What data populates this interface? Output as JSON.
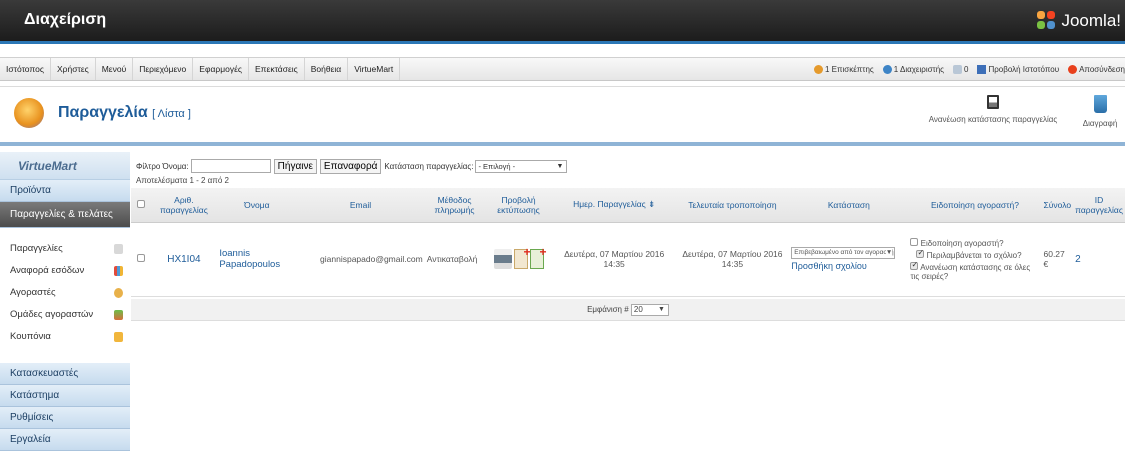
{
  "header": {
    "title": "Διαχείριση",
    "brand": "Joomla!"
  },
  "menu": [
    "Ιστότοπος",
    "Χρήστες",
    "Μενού",
    "Περιεχόμενο",
    "Εφαρμογές",
    "Επεκτάσεις",
    "Βοήθεια",
    "VirtueMart"
  ],
  "status": {
    "visitors": "1 Επισκέπτης",
    "admins": "1 Διαχειριστής",
    "messages": "0",
    "view_site": "Προβολή Ιστοτόπου",
    "logout": "Αποσύνδεση"
  },
  "toolbar": {
    "title": "Παραγγελία",
    "subtitle": "[ Λίστα ]",
    "update_status": "Ανανέωση κατάστασης παραγγελίας",
    "delete": "Διαγραφή"
  },
  "sidebar": {
    "logo": "VirtueMart",
    "products": "Προϊόντα",
    "orders_customers": "Παραγγελίες & πελάτες",
    "sub_items": [
      "Παραγγελίες",
      "Αναφορά εσόδων",
      "Αγοραστές",
      "Ομάδες αγοραστών",
      "Κουπόνια"
    ],
    "sections": [
      "Κατασκευαστές",
      "Κατάστημα",
      "Ρυθμίσεις",
      "Εργαλεία"
    ]
  },
  "filters": {
    "name_label": "Φίλτρο Όνομα:",
    "go": "Πήγαινε",
    "reset": "Επαναφορά",
    "status_label": "Κατάσταση παραγγελίας:",
    "status_value": "- Επιλογή -",
    "results": "Αποτελέσματα 1 - 2 από 2"
  },
  "columns": {
    "order_no": "Αριθ. παραγγελίας",
    "name": "Όνομα",
    "email": "Email",
    "payment": "Μέθοδος πληρωμής",
    "print": "Προβολή εκτύπωσης",
    "date": "Ημερ. Παραγγελίας",
    "modified": "Τελευταία τροποποίηση",
    "status": "Κατάσταση",
    "notify": "Ειδοποίηση αγοραστή?",
    "total": "Σύνολο",
    "id": "ID παραγγελίας"
  },
  "rows": [
    {
      "order_no": "HX1I04",
      "name": "Ioannis Papadopoulos",
      "email": "giannispapado@gmail.com",
      "payment": "Αντικαταβολή",
      "date": "Δευτέρα, 07 Μαρτίου 2016 14:35",
      "modified": "Δευτέρα, 07 Μαρτίου 2016 14:35",
      "status": "Επιβεβαιωμένο από τον αγοραστή",
      "add_comment": "Προσθήκη σχολίου",
      "notify_buyer": "Ειδοποίηση αγοραστή?",
      "include_comment": "Περιλαμβάνεται το σχόλιο?",
      "update_all": "Ανανέωση κατάστασης σε όλες τις σειρές?",
      "total": "60.27 €",
      "id": "2"
    }
  ],
  "pager": {
    "label": "Εμφάνιση #",
    "value": "20"
  }
}
